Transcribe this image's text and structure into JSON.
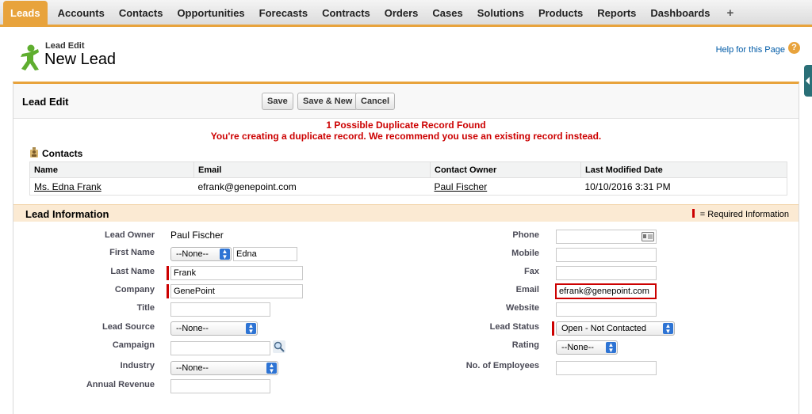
{
  "tabs": [
    "Leads",
    "Accounts",
    "Contacts",
    "Opportunities",
    "Forecasts",
    "Contracts",
    "Orders",
    "Cases",
    "Solutions",
    "Products",
    "Reports",
    "Dashboards"
  ],
  "tab_plus": "+",
  "header": {
    "type_label": "Lead Edit",
    "title": "New Lead",
    "help": "Help for this Page",
    "help_icon": "?"
  },
  "block": {
    "title": "Lead Edit",
    "save": "Save",
    "save_new": "Save & New",
    "cancel": "Cancel"
  },
  "duplicate": {
    "title": "1 Possible Duplicate Record Found",
    "message": "You're creating a duplicate record. We recommend you use an existing record instead.",
    "section": "Contacts",
    "columns": [
      "Name",
      "Email",
      "Contact Owner",
      "Last Modified Date"
    ],
    "rows": [
      [
        "Ms. Edna Frank",
        "efrank@genepoint.com",
        "Paul Fischer",
        "10/10/2016 3:31 PM"
      ]
    ]
  },
  "section": {
    "title": "Lead Information",
    "required_legend": "= Required Information"
  },
  "fields": {
    "lead_owner": {
      "label": "Lead Owner",
      "value": "Paul Fischer"
    },
    "first_name": {
      "label": "First Name",
      "salutation": "--None--",
      "value": "Edna"
    },
    "last_name": {
      "label": "Last Name",
      "value": "Frank"
    },
    "company": {
      "label": "Company",
      "value": "GenePoint"
    },
    "title": {
      "label": "Title",
      "value": ""
    },
    "lead_source": {
      "label": "Lead Source",
      "value": "--None--"
    },
    "campaign": {
      "label": "Campaign",
      "value": ""
    },
    "industry": {
      "label": "Industry",
      "value": "--None--"
    },
    "annual_revenue": {
      "label": "Annual Revenue",
      "value": ""
    },
    "phone": {
      "label": "Phone",
      "value": ""
    },
    "mobile": {
      "label": "Mobile",
      "value": ""
    },
    "fax": {
      "label": "Fax",
      "value": ""
    },
    "email": {
      "label": "Email",
      "value": "efrank@genepoint.com"
    },
    "website": {
      "label": "Website",
      "value": ""
    },
    "lead_status": {
      "label": "Lead Status",
      "value": "Open - Not Contacted"
    },
    "rating": {
      "label": "Rating",
      "value": "--None--"
    },
    "employees": {
      "label": "No. of Employees",
      "value": ""
    }
  },
  "colors": {
    "accent": "#e8a33c",
    "error": "#cc0000",
    "section_bg": "#fbead3",
    "select_arrow": "#2e74d4"
  }
}
